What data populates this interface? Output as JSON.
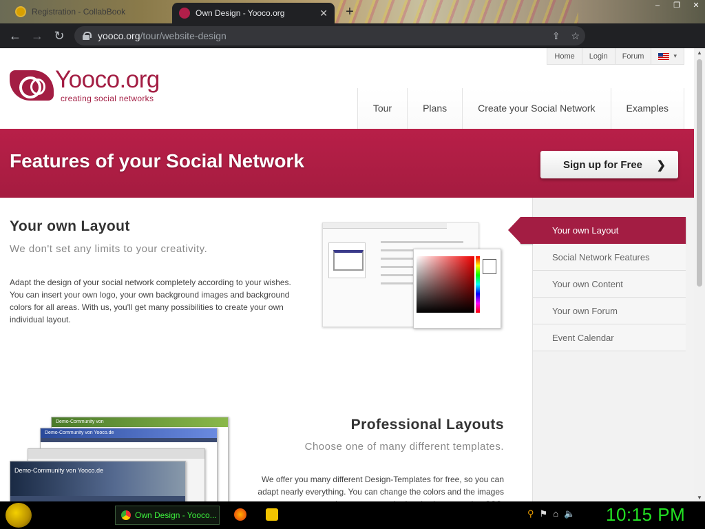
{
  "browser": {
    "tabs": [
      {
        "title": "Registration - CollabBook",
        "active": false
      },
      {
        "title": "Own Design - Yooco.org",
        "active": true
      }
    ],
    "new_tab_label": "+",
    "address": {
      "host": "yooco.org",
      "path": "/tour/website-design"
    }
  },
  "site": {
    "top_menu": [
      "Home",
      "Login",
      "Forum"
    ],
    "lang_arrow": "▾",
    "logo": {
      "name": "Yooco.org",
      "tagline": "creating social networks"
    },
    "main_nav": [
      "Tour",
      "Plans",
      "Create your Social Network",
      "Examples"
    ],
    "banner": {
      "title": "Features of your Social Network",
      "cta": "Sign up for Free",
      "cta_arrow": "❯"
    },
    "sections": [
      {
        "title": "Your own Layout",
        "subtitle": "We don't set any limits to your creativity.",
        "body": "Adapt the design of your social network completely according to your wishes. You can insert your own logo, your own background images and background colors for all areas. With us, you'll get many possibilities to create your own individual layout."
      },
      {
        "title": "Professional Layouts",
        "subtitle": "Choose one of many different templates.",
        "body": "We offer you many different Design-Templates for free, so you can adapt nearly everything. You can change the colors and the images and you can even do drastic changes using CSS."
      }
    ],
    "template_captions": [
      "Demo-Community von",
      "Demo-Community von Yooco.de",
      "Demo-Community von Yooco.de"
    ],
    "sidebar": [
      {
        "label": "Your own Layout",
        "active": true
      },
      {
        "label": "Social Network Features",
        "active": false
      },
      {
        "label": "Your own Content",
        "active": false
      },
      {
        "label": "Your own Forum",
        "active": false
      },
      {
        "label": "Event Calendar",
        "active": false
      }
    ]
  },
  "taskbar": {
    "active_task": "Own Design - Yooco...",
    "clock": "10:15 PM"
  },
  "colors": {
    "brand": "#a31d43",
    "clock": "#22e022"
  }
}
